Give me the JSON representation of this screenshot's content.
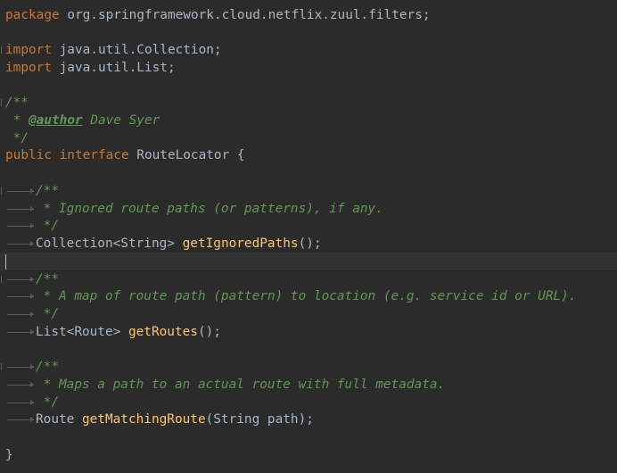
{
  "editor": {
    "lines": {
      "package_kw": "package",
      "package_name": " org.springframework.cloud.netflix.zuul.filters;",
      "import_kw": "import",
      "import1_name": " java.util.Collection;",
      "import2_name": " java.util.List;",
      "doc_open": "/**",
      "author_prefix": " * ",
      "author_tag": "@author",
      "author_name": " Dave Syer",
      "doc_close": " */",
      "public_kw": "public",
      "interface_kw": " interface",
      "interface_name": " RouteLocator {",
      "m1_doc_open": "/**",
      "m1_doc_text": " * Ignored route paths (or patterns), if any.",
      "m1_doc_close": " */",
      "m1_return": "Collection<String> ",
      "m1_name": "getIgnoredPaths",
      "m1_suffix": "();",
      "m2_doc_open": "/**",
      "m2_doc_text": " * A map of route path (pattern) to location (e.g. service id or URL).",
      "m2_doc_close": " */",
      "m2_return": "List<Route> ",
      "m2_name": "getRoutes",
      "m2_suffix": "();",
      "m3_doc_open": "/**",
      "m3_doc_text": " * Maps a path to an actual route with full metadata.",
      "m3_doc_close": " */",
      "m3_return": "Route ",
      "m3_name": "getMatchingRoute",
      "m3_suffix": "(String path);",
      "close_brace": "}"
    },
    "colors": {
      "background": "#2b2b2b",
      "keyword": "#cc7832",
      "comment": "#629755",
      "method": "#ffc66d",
      "text": "#a9b7c6"
    }
  }
}
